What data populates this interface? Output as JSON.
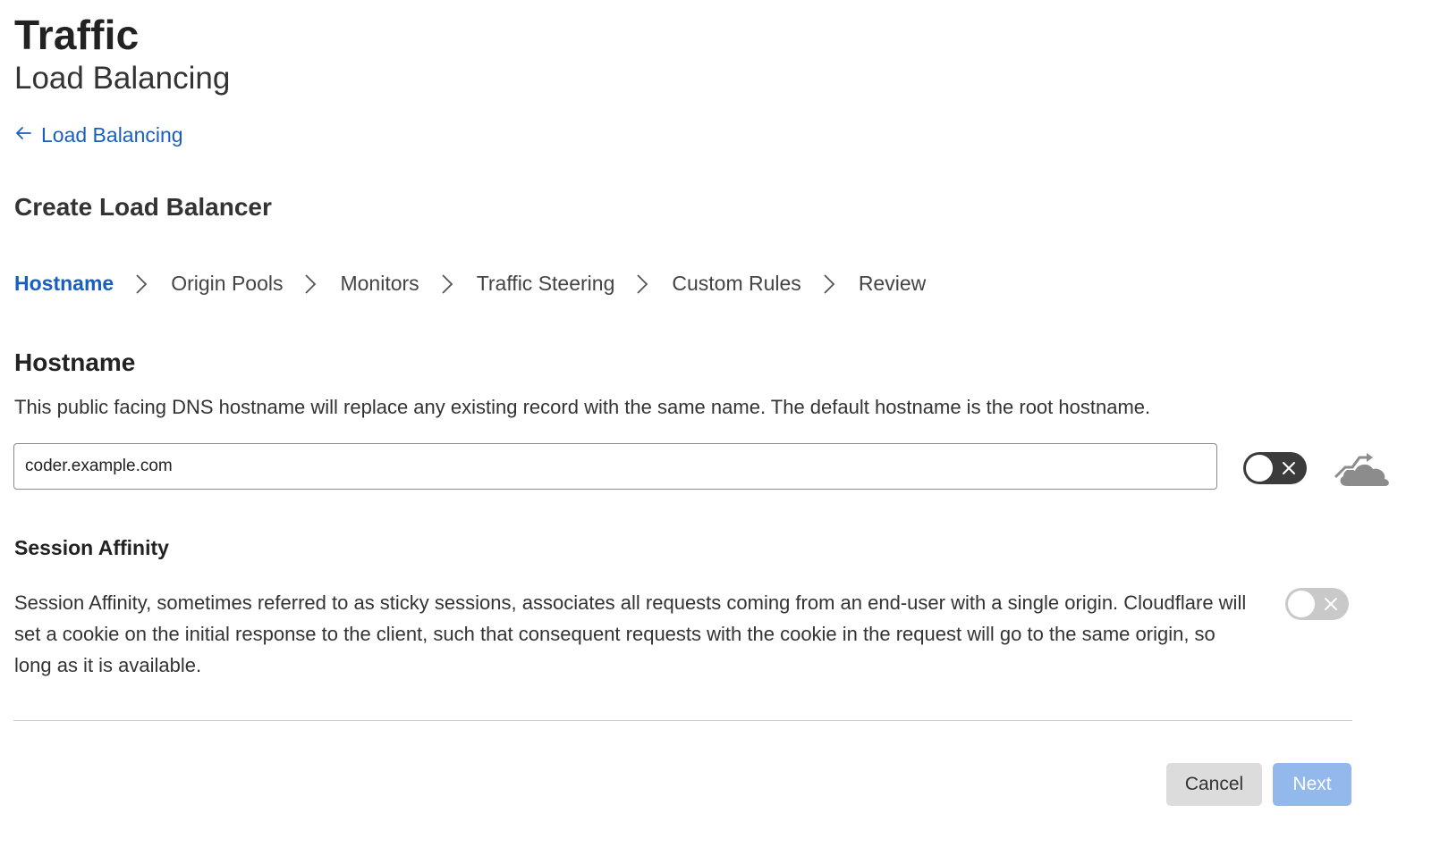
{
  "header": {
    "title": "Traffic",
    "subtitle": "Load Balancing"
  },
  "back_link": {
    "arrow_icon": "arrow-left-icon",
    "label": "Load Balancing"
  },
  "wizard": {
    "title": "Create Load Balancer",
    "steps": [
      {
        "label": "Hostname",
        "active": true
      },
      {
        "label": "Origin Pools",
        "active": false
      },
      {
        "label": "Monitors",
        "active": false
      },
      {
        "label": "Traffic Steering",
        "active": false
      },
      {
        "label": "Custom Rules",
        "active": false
      },
      {
        "label": "Review",
        "active": false
      }
    ]
  },
  "hostname": {
    "heading": "Hostname",
    "description": "This public facing DNS hostname will replace any existing record with the same name. The default hostname is the root hostname.",
    "value": "coder.example.com",
    "proxy_toggle": {
      "state": "off",
      "icon": "dns-only-cloud-icon"
    }
  },
  "session_affinity": {
    "heading": "Session Affinity",
    "description": "Session Affinity, sometimes referred to as sticky sessions, associates all requests coming from an end-user with a single origin. Cloudflare will set a cookie on the initial response to the client, such that consequent requests with the cookie in the request will go to the same origin, so long as it is available.",
    "toggle": {
      "state": "off"
    }
  },
  "footer": {
    "cancel_label": "Cancel",
    "next_label": "Next"
  },
  "colors": {
    "accent": "#1a5fc0",
    "next_button": "#93b8ec",
    "cancel_button": "#dcdcdc",
    "toggle_dark": "#3b3b3b",
    "toggle_light": "#c9c9c9"
  }
}
